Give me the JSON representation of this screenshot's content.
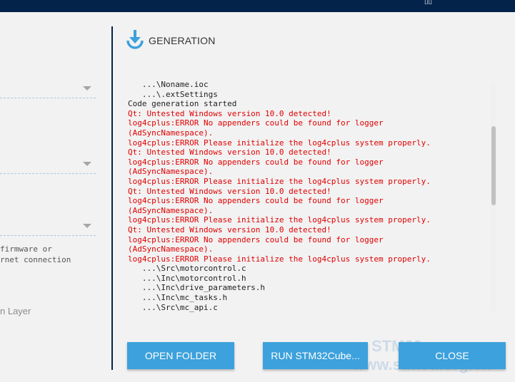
{
  "generation": {
    "title": "GENERATION",
    "icon": "download-icon"
  },
  "left_panel": {
    "note_lines": [
      "firmware or",
      "rnet connection"
    ],
    "layer_label": "n Layer"
  },
  "log": [
    {
      "text": "   ...\\Noname.ioc",
      "level": "ok"
    },
    {
      "text": "   ...\\.extSettings",
      "level": "ok"
    },
    {
      "text": "Code generation started",
      "level": "ok"
    },
    {
      "text": "Qt: Untested Windows version 10.0 detected!",
      "level": "err"
    },
    {
      "text": "log4cplus:ERROR No appenders could be found for logger",
      "level": "err"
    },
    {
      "text": "(AdSyncNamespace).",
      "level": "err"
    },
    {
      "text": "log4cplus:ERROR Please initialize the log4cplus system properly.",
      "level": "err"
    },
    {
      "text": "Qt: Untested Windows version 10.0 detected!",
      "level": "err"
    },
    {
      "text": "log4cplus:ERROR No appenders could be found for logger",
      "level": "err"
    },
    {
      "text": "(AdSyncNamespace).",
      "level": "err"
    },
    {
      "text": "log4cplus:ERROR Please initialize the log4cplus system properly.",
      "level": "err"
    },
    {
      "text": "Qt: Untested Windows version 10.0 detected!",
      "level": "err"
    },
    {
      "text": "log4cplus:ERROR No appenders could be found for logger",
      "level": "err"
    },
    {
      "text": "(AdSyncNamespace).",
      "level": "err"
    },
    {
      "text": "log4cplus:ERROR Please initialize the log4cplus system properly.",
      "level": "err"
    },
    {
      "text": "Qt: Untested Windows version 10.0 detected!",
      "level": "err"
    },
    {
      "text": "log4cplus:ERROR No appenders could be found for logger",
      "level": "err"
    },
    {
      "text": "(AdSyncNamespace).",
      "level": "err"
    },
    {
      "text": "log4cplus:ERROR Please initialize the log4cplus system properly.",
      "level": "err"
    },
    {
      "text": "   ...\\Src\\motorcontrol.c",
      "level": "ok"
    },
    {
      "text": "   ...\\Inc\\motorcontrol.h",
      "level": "ok"
    },
    {
      "text": "   ...\\Inc\\drive_parameters.h",
      "level": "ok"
    },
    {
      "text": "   ...\\Inc\\mc_tasks.h",
      "level": "ok"
    },
    {
      "text": "   ...\\Src\\mc_api.c",
      "level": "ok"
    }
  ],
  "buttons": {
    "open_folder": "OPEN FOLDER",
    "run_stm32cube": "RUN STM32Cube...",
    "close": "CLOSE"
  },
  "watermark": {
    "line1": "STM32",
    "line2": "www.stmcu.org.cn"
  },
  "colors": {
    "accent": "#3ca1dc",
    "header_bar": "#03234b",
    "error_text": "#e00000"
  }
}
